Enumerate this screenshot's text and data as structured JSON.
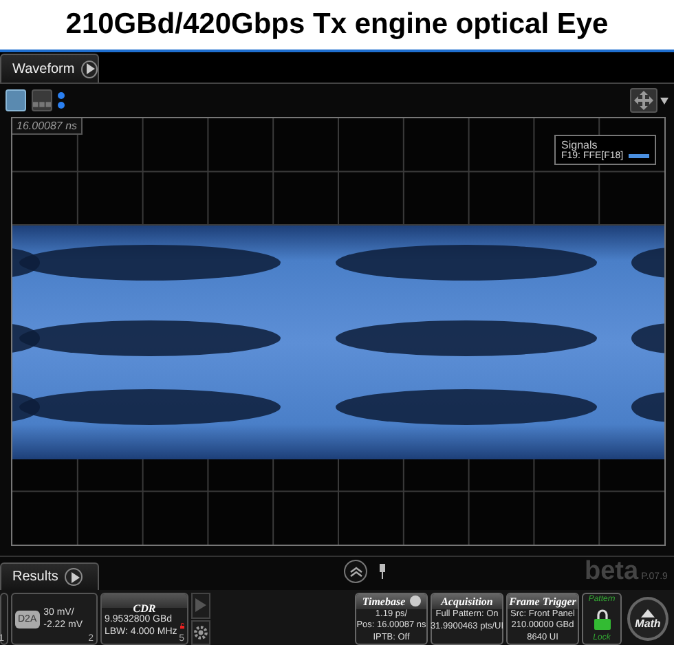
{
  "title": "210GBd/420Gbps Tx engine optical Eye",
  "waveform_tab": {
    "label": "Waveform"
  },
  "graticule": {
    "timestamp": "16.00087 ns"
  },
  "signals_legend": {
    "title": "Signals",
    "entries": [
      {
        "label": "F19: FFE[F18]",
        "color": "#4a8fe0"
      }
    ]
  },
  "results_tab": {
    "label": "Results"
  },
  "channel_tiles": [
    {
      "kind": "edge",
      "number": "1"
    },
    {
      "kind": "channel",
      "badge": "D2A",
      "lines": [
        "30 mV/",
        "-2.22 mV"
      ],
      "number": "2"
    },
    {
      "kind": "cdr",
      "title": "CDR",
      "lines": [
        "9.9532800 GBd",
        "LBW: 4.000 MHz"
      ],
      "locked": false,
      "number": "5"
    }
  ],
  "version_mark": {
    "name": "beta",
    "version": "P.07.9"
  },
  "panels": [
    {
      "title": "Timebase",
      "lines": [
        "1.19 ps/",
        "Pos: 16.00087 ns",
        "IPTB: Off"
      ]
    },
    {
      "title": "Acquisition",
      "lines": [
        "Full Pattern: On",
        "31.9900463 pts/UI"
      ]
    },
    {
      "title": "Frame Trigger",
      "lines": [
        "Src: Front Panel",
        "210.00000 GBd",
        "8640 UI"
      ]
    }
  ],
  "pattern_lock": {
    "top": "Pattern",
    "bottom": "Lock",
    "locked": true
  },
  "math_button": {
    "label": "Math"
  }
}
